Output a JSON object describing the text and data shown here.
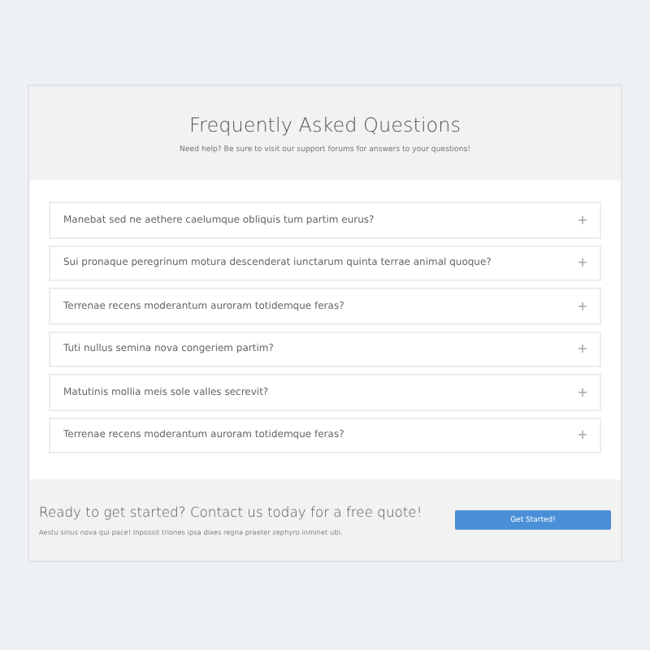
{
  "header": {
    "title": "Frequently Asked Questions",
    "subtitle": "Need help? Be sure to visit our support forums for answers to your questions!"
  },
  "faqs": [
    {
      "question": "Manebat sed ne aethere caelumque obliquis tum partim eurus?",
      "expanded": false
    },
    {
      "question": "Sui pronaque peregrinum motura descenderat iunctarum quinta terrae animal quoque?",
      "expanded": false
    },
    {
      "question": "Terrenae recens moderantum auroram totidemque feras?",
      "expanded": false
    },
    {
      "question": "Tuti nullus semina nova congeriem partim?",
      "expanded": false
    },
    {
      "question": "Matutinis mollia meis sole valles secrevit?",
      "expanded": false
    },
    {
      "question": "Terrenae recens moderantum auroram totidemque feras?",
      "expanded": false
    }
  ],
  "cta": {
    "title": "Ready to get started? Contact us today for a free quote!",
    "text": "Aestu sinus nova qui pace! Inpossit triones ipsa dixes regna praeter zephyro inminet ubi.",
    "button": "Get Started!"
  }
}
